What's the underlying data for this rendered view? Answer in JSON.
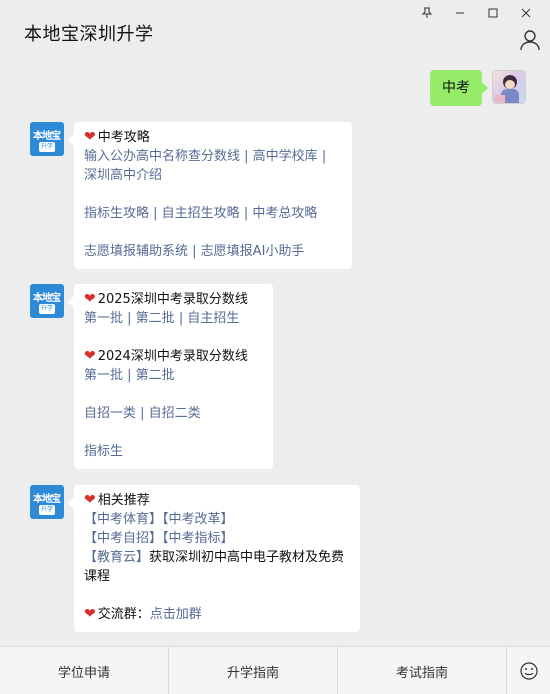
{
  "header": {
    "title": "本地宝深圳升学"
  },
  "chat": {
    "mine": {
      "text": "中考"
    },
    "msg1": {
      "logo_text1": "本地宝",
      "logo_text2": "升学",
      "heading": "中考攻略",
      "links_a": [
        "输入公办高中名称查分数线",
        "高中学校库"
      ],
      "link_a3": "深圳高中介绍",
      "links_b": [
        "指标生攻略",
        "自主招生攻略",
        "中考总攻略"
      ],
      "links_c": [
        "志愿填报辅助系统",
        "志愿填报AI小助手"
      ]
    },
    "msg2": {
      "heading1": "2025深圳中考录取分数线",
      "links1": [
        "第一批",
        "第二批",
        "自主招生"
      ],
      "heading2": "2024深圳中考录取分数线",
      "links2": [
        "第一批",
        "第二批"
      ],
      "links3": [
        "自招一类",
        "自招二类"
      ],
      "link4": "指标生"
    },
    "msg3": {
      "heading": "相关推荐",
      "row1": [
        "【中考体育】",
        "【中考改革】"
      ],
      "row2": [
        "【中考自招】",
        "【中考指标】"
      ],
      "row3_link": "【教育云】",
      "row3_text": "获取深圳初中高中电子教材及免费课程",
      "group_label": "交流群：",
      "group_link": "点击加群"
    }
  },
  "menu": {
    "items": [
      "学位申请",
      "升学指南",
      "考试指南"
    ]
  },
  "colors": {
    "link": "#576b95",
    "mine_bubble": "#95ec69",
    "heart": "#d8302f",
    "logo": "#2d8ad7"
  }
}
